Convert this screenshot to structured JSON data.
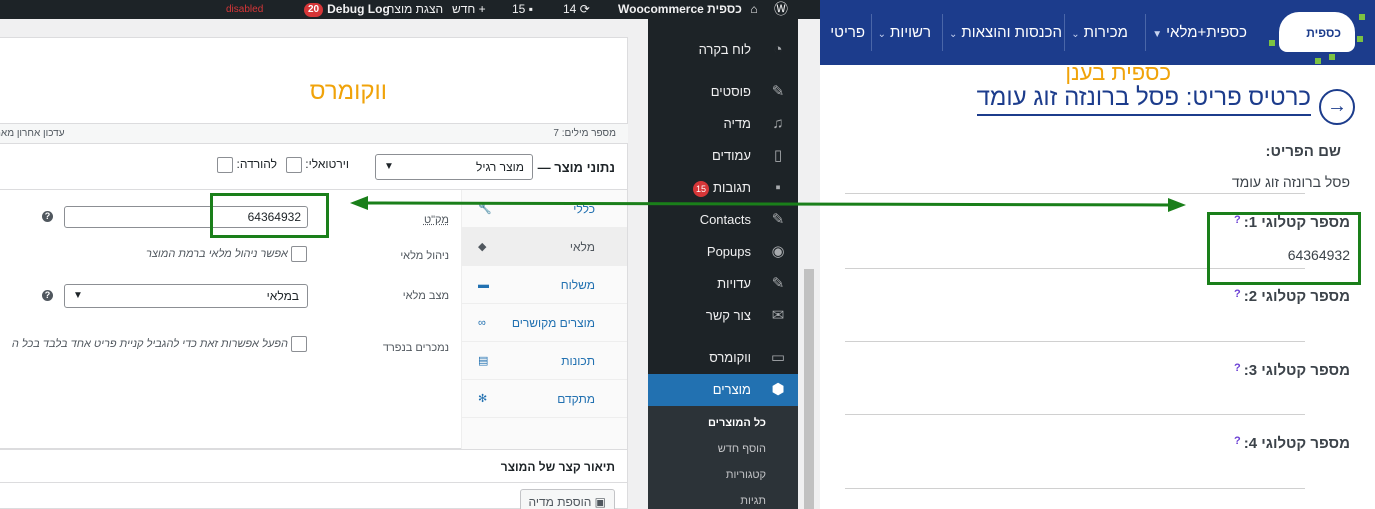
{
  "adminbar": {
    "site_name": "כספית Woocommerce",
    "updates_count": "14",
    "comments_count": "15",
    "new_label": "חדש",
    "view_product": "הצגת מוצר",
    "debug_label": "Debug Log",
    "debug_count": "20",
    "debug_status": "disabled"
  },
  "editor": {
    "post_title": "ווקומרס",
    "word_count": "מספר מילים: 7",
    "last_edit": "עדכון אחרון מאת"
  },
  "product_data": {
    "title": "נתוני מוצר —",
    "type_value": "מוצר רגיל",
    "virtual_label": "וירטואלי:",
    "download_label": "להורדה:",
    "tabs": [
      {
        "label": "כללי",
        "icon": "wrench-icon"
      },
      {
        "label": "מלאי",
        "icon": "tag-icon"
      },
      {
        "label": "משלוח",
        "icon": "truck-icon"
      },
      {
        "label": "מוצרים מקושרים",
        "icon": "link-icon"
      },
      {
        "label": "תכונות",
        "icon": "table-icon"
      },
      {
        "label": "מתקדם",
        "icon": "gear-icon"
      }
    ],
    "sku_label": "מק\"ט",
    "sku_value": "64364932",
    "manage_stock_label": "ניהול מלאי",
    "manage_stock_text": "אפשר ניהול מלאי ברמת המוצר",
    "stock_status_label": "מצב מלאי",
    "stock_status_value": "במלאי",
    "sold_individually_label": "נמכרים בנפרד",
    "sold_individually_text": "הפעל אפשרות זאת כדי להגביל קניית פריט אחד בלבד בכל ה"
  },
  "short_description": {
    "title": "תיאור קצר של המוצר",
    "add_media": "הוספת מדיה"
  },
  "admin_menu": {
    "items": [
      {
        "label": "לוח בקרה",
        "icon": "dashboard-icon"
      },
      {
        "label": "פוסטים",
        "icon": "pin-icon"
      },
      {
        "label": "מדיה",
        "icon": "media-icon"
      },
      {
        "label": "עמודים",
        "icon": "pages-icon"
      },
      {
        "label": "תגובות",
        "icon": "comments-icon",
        "badge": "15"
      },
      {
        "label": "Contacts",
        "icon": "pin-icon"
      },
      {
        "label": "Popups",
        "icon": "eye-icon"
      },
      {
        "label": "עדויות",
        "icon": "pin-icon"
      },
      {
        "label": "צור קשר",
        "icon": "mail-icon"
      },
      {
        "label": "ווקומרס",
        "icon": "woo-icon"
      },
      {
        "label": "מוצרים",
        "icon": "box-icon"
      }
    ],
    "sub_items": [
      "כל המוצרים",
      "הוסף חדש",
      "קטגוריות",
      "תגיות"
    ]
  },
  "kaspit": {
    "nav": [
      "כספית+מלאי",
      "מכירות",
      "הכנסות והוצאות",
      "רשויות",
      "פריטי"
    ],
    "logo_text": "כספית",
    "brand_title": "כספית בענן",
    "page_title": "כרטיס פריט: פסל ברונזה זוג עומד",
    "item_name_label": "שם הפריט:",
    "item_name_value": "פסל ברונזה זוג עומד",
    "catalog": [
      {
        "label": "מספר קטלוגי 1:",
        "value": "64364932"
      },
      {
        "label": "מספר קטלוגי 2:",
        "value": ""
      },
      {
        "label": "מספר קטלוגי 3:",
        "value": ""
      },
      {
        "label": "מספר קטלוגי 4:",
        "value": ""
      }
    ],
    "help_mark": "?",
    "colors": {
      "nav_bg": "#1c3c8c",
      "brand": "#f0a30a",
      "highlight": "#1a7f1a"
    }
  }
}
